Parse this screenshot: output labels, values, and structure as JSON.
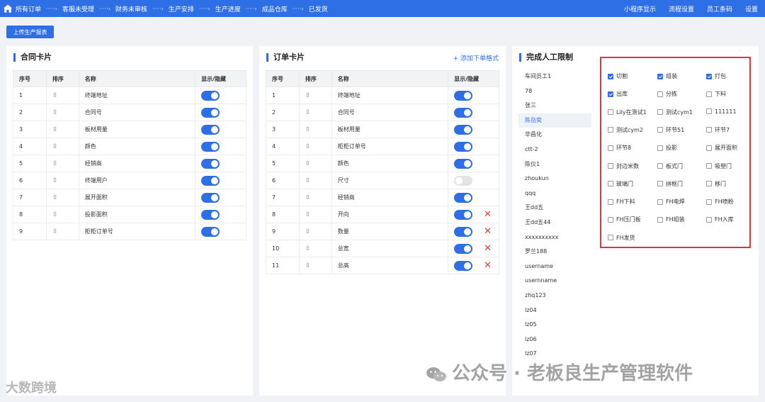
{
  "topbar": {
    "crumbs": [
      "所有订单",
      "客服未受理",
      "财务未审核",
      "生产安排",
      "生产进度",
      "成品仓库",
      "已发货"
    ],
    "separator": "·····›",
    "right_links": [
      "小程序显示",
      "流程设置",
      "员工条码",
      "设置"
    ]
  },
  "upload_button": "上传生产报表",
  "contract_card": {
    "title": "合同卡片",
    "headers": [
      "序号",
      "排序",
      "名称",
      "显示/隐藏"
    ],
    "rows": [
      {
        "no": "1",
        "sort": "⇳",
        "name": "终端地址",
        "on": true
      },
      {
        "no": "2",
        "sort": "⇳",
        "name": "合同号",
        "on": true
      },
      {
        "no": "3",
        "sort": "⇳",
        "name": "板材用量",
        "on": true
      },
      {
        "no": "4",
        "sort": "⇳",
        "name": "颜色",
        "on": true
      },
      {
        "no": "5",
        "sort": "⇳",
        "name": "经销商",
        "on": true
      },
      {
        "no": "6",
        "sort": "⇳",
        "name": "终端用户",
        "on": true
      },
      {
        "no": "7",
        "sort": "⇳",
        "name": "展开面积",
        "on": true
      },
      {
        "no": "8",
        "sort": "⇳",
        "name": "投影面积",
        "on": true
      },
      {
        "no": "9",
        "sort": "⇳",
        "name": "柜柜订单号",
        "on": true
      }
    ]
  },
  "order_card": {
    "title": "订单卡片",
    "add_link": "+ 添加下单格式",
    "headers": [
      "序号",
      "排序",
      "名称",
      "显示/隐藏"
    ],
    "rows": [
      {
        "no": "1",
        "sort": "⇳",
        "name": "终端地址",
        "on": true,
        "deletable": false
      },
      {
        "no": "2",
        "sort": "⇳",
        "name": "合同号",
        "on": true,
        "deletable": false
      },
      {
        "no": "3",
        "sort": "⇳",
        "name": "板材用量",
        "on": true,
        "deletable": false
      },
      {
        "no": "4",
        "sort": "⇳",
        "name": "柜柜订单号",
        "on": true,
        "deletable": false
      },
      {
        "no": "5",
        "sort": "⇳",
        "name": "颜色",
        "on": true,
        "deletable": false
      },
      {
        "no": "6",
        "sort": "⇳",
        "name": "尺寸",
        "on": false,
        "deletable": false
      },
      {
        "no": "7",
        "sort": "⇳",
        "name": "经销商",
        "on": true,
        "deletable": false
      },
      {
        "no": "8",
        "sort": "⇳",
        "name": "开向",
        "on": true,
        "deletable": true
      },
      {
        "no": "9",
        "sort": "⇳",
        "name": "数量",
        "on": true,
        "deletable": true
      },
      {
        "no": "10",
        "sort": "⇳",
        "name": "总宽",
        "on": true,
        "deletable": true
      },
      {
        "no": "11",
        "sort": "⇳",
        "name": "总高",
        "on": true,
        "deletable": true
      }
    ]
  },
  "manual_limit": {
    "title": "完成人工限制",
    "users": [
      "车间员工1",
      "78",
      "张三",
      "陈岳奕",
      "华昌化",
      "ctt-2",
      "陈仪1",
      "zhoukun",
      "qqq",
      "王dd五",
      "王dd五44",
      "xxxxxxxxxx",
      "罗兰188",
      "username",
      "usernname",
      "zhq123",
      "lz04",
      "lz05",
      "lz06",
      "lz07"
    ],
    "selected_user": "陈岳奕",
    "options": [
      {
        "label": "切割",
        "checked": true
      },
      {
        "label": "组装",
        "checked": true
      },
      {
        "label": "打包",
        "checked": true
      },
      {
        "label": "出库",
        "checked": true
      },
      {
        "label": "分拣",
        "checked": false
      },
      {
        "label": "下料",
        "checked": false
      },
      {
        "label": "Lily在测试1",
        "checked": false
      },
      {
        "label": "测试cym1",
        "checked": false
      },
      {
        "label": "111111",
        "checked": false
      },
      {
        "label": "测试cym2",
        "checked": false
      },
      {
        "label": "环节51",
        "checked": false
      },
      {
        "label": "环节7",
        "checked": false
      },
      {
        "label": "环节8",
        "checked": false
      },
      {
        "label": "投影",
        "checked": false
      },
      {
        "label": "展开面积",
        "checked": false
      },
      {
        "label": "封边米数",
        "checked": false
      },
      {
        "label": "板式门",
        "checked": false
      },
      {
        "label": "吸塑门",
        "checked": false
      },
      {
        "label": "玻璃门",
        "checked": false
      },
      {
        "label": "拼框门",
        "checked": false
      },
      {
        "label": "移门",
        "checked": false
      },
      {
        "label": "FH下料",
        "checked": false
      },
      {
        "label": "FH电焊",
        "checked": false
      },
      {
        "label": "FH喷粉",
        "checked": false
      },
      {
        "label": "FH压门板",
        "checked": false
      },
      {
        "label": "FH组装",
        "checked": false
      },
      {
        "label": "FH入库",
        "checked": false
      },
      {
        "label": "FH发货",
        "checked": false
      }
    ]
  },
  "watermark": {
    "main": "公众号 · 老板良生产管理软件",
    "corner": "大数跨境"
  },
  "colors": {
    "primary": "#2f6fe6",
    "highlight_border": "#d9363e",
    "delete": "#e23c3c"
  }
}
